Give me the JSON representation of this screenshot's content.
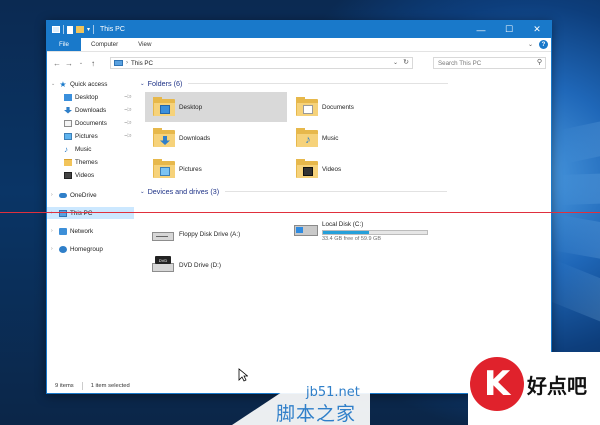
{
  "window": {
    "title": "This PC",
    "controls": {
      "minimize": "—",
      "maximize": "☐",
      "close": "✕"
    }
  },
  "ribbon": {
    "tabs": [
      "File",
      "Computer",
      "View"
    ]
  },
  "address": {
    "location": "This PC",
    "search_placeholder": "Search This PC"
  },
  "nav": {
    "items": [
      {
        "label": "Quick access",
        "icon": "star-icon"
      },
      {
        "label": "Desktop",
        "icon": "desktop-icon",
        "pinned": true
      },
      {
        "label": "Downloads",
        "icon": "downloads-icon",
        "pinned": true
      },
      {
        "label": "Documents",
        "icon": "documents-icon",
        "pinned": true
      },
      {
        "label": "Pictures",
        "icon": "pictures-icon",
        "pinned": true
      },
      {
        "label": "Music",
        "icon": "music-icon"
      },
      {
        "label": "Themes",
        "icon": "folder-icon"
      },
      {
        "label": "Videos",
        "icon": "videos-icon"
      },
      {
        "label": "OneDrive",
        "icon": "onedrive-icon"
      },
      {
        "label": "This PC",
        "icon": "this-pc-icon",
        "selected": true
      },
      {
        "label": "Network",
        "icon": "network-icon"
      },
      {
        "label": "Homegroup",
        "icon": "homegroup-icon"
      }
    ]
  },
  "folders": {
    "header": "Folders (6)",
    "items": [
      {
        "label": "Desktop",
        "icon": "desktop-folder-icon",
        "selected": true
      },
      {
        "label": "Documents",
        "icon": "documents-folder-icon"
      },
      {
        "label": "Downloads",
        "icon": "downloads-folder-icon"
      },
      {
        "label": "Music",
        "icon": "music-folder-icon"
      },
      {
        "label": "Pictures",
        "icon": "pictures-folder-icon"
      },
      {
        "label": "Videos",
        "icon": "videos-folder-icon"
      }
    ]
  },
  "drives": {
    "header": "Devices and drives (3)",
    "floppy": {
      "label": "Floppy Disk Drive (A:)"
    },
    "local": {
      "label": "Local Disk (C:)",
      "free_text": "33.4 GB free of 59.9 GB",
      "used_fraction": 0.44
    },
    "dvd": {
      "label": "DVD Drive (D:)",
      "badge": "DVD"
    }
  },
  "status": {
    "count": "9 items",
    "selection": "1 item selected"
  },
  "watermarks": {
    "site": "jb51.net",
    "site_cn": "脚本之家",
    "brand_cn": "好点吧",
    "brand_logo": "K"
  },
  "colors": {
    "accent": "#1979ca",
    "selection": "#cce8ff",
    "guide_line": "#e0303d",
    "disk_bar": "#26a0da"
  }
}
